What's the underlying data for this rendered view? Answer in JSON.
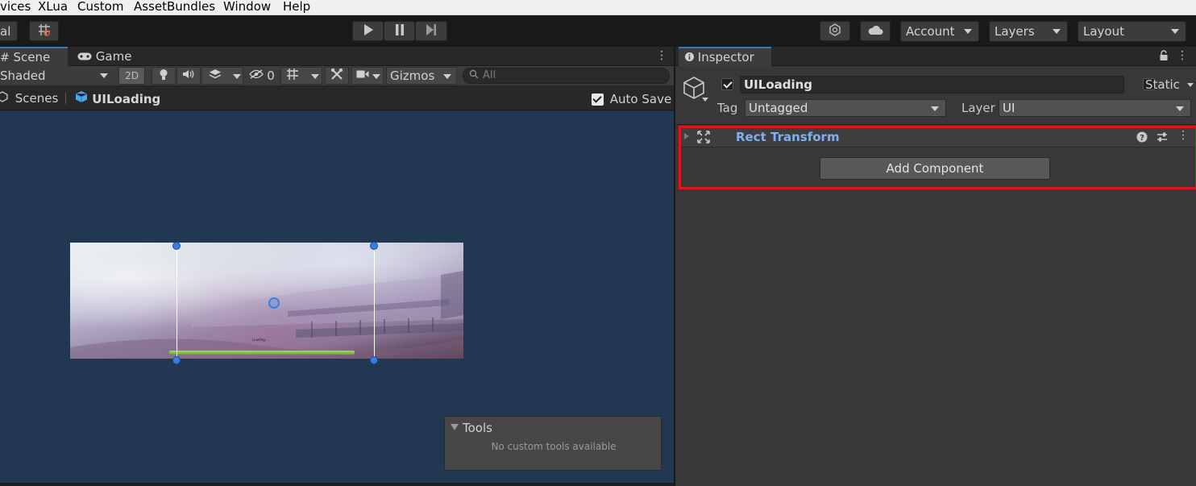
{
  "menu": {
    "items": [
      "vices",
      "XLua",
      "Custom",
      "AssetBundles",
      "Window",
      "Help"
    ]
  },
  "toolbar": {
    "left_partial": "al",
    "account_label": "Account",
    "layers_label": "Layers",
    "layout_label": "Layout",
    "icons": [
      "snap-grid-icon",
      "play-icon",
      "pause-icon",
      "step-icon",
      "collab-icon",
      "cloud-icon"
    ]
  },
  "scene": {
    "tabs": [
      "Scene",
      "Game"
    ],
    "shading_mode": "Shaded",
    "mode_2d": "2D",
    "hidden_count": "0",
    "gizmos_label": "Gizmos",
    "search_placeholder": "All",
    "breadcrumb_root": "Scenes",
    "breadcrumb_prefab": "UILoading",
    "auto_save_label": "Auto Save",
    "auto_save_checked": true,
    "loading_text": "Loading...",
    "tools_overlay": {
      "title": "Tools",
      "message": "No custom tools available"
    }
  },
  "inspector": {
    "tab_label": "Inspector",
    "object_name": "UILoading",
    "active": true,
    "static_label": "Static",
    "tag_label": "Tag",
    "tag_value": "Untagged",
    "layer_label": "Layer",
    "layer_value": "UI",
    "component_name": "Rect Transform",
    "add_component_label": "Add Component"
  },
  "colors": {
    "accent_blue": "#3a79bb",
    "viewport_bg": "#223752",
    "highlight_red": "#e0141e",
    "component_title": "#7fb0ef",
    "progress_green": "#7ec33a"
  }
}
